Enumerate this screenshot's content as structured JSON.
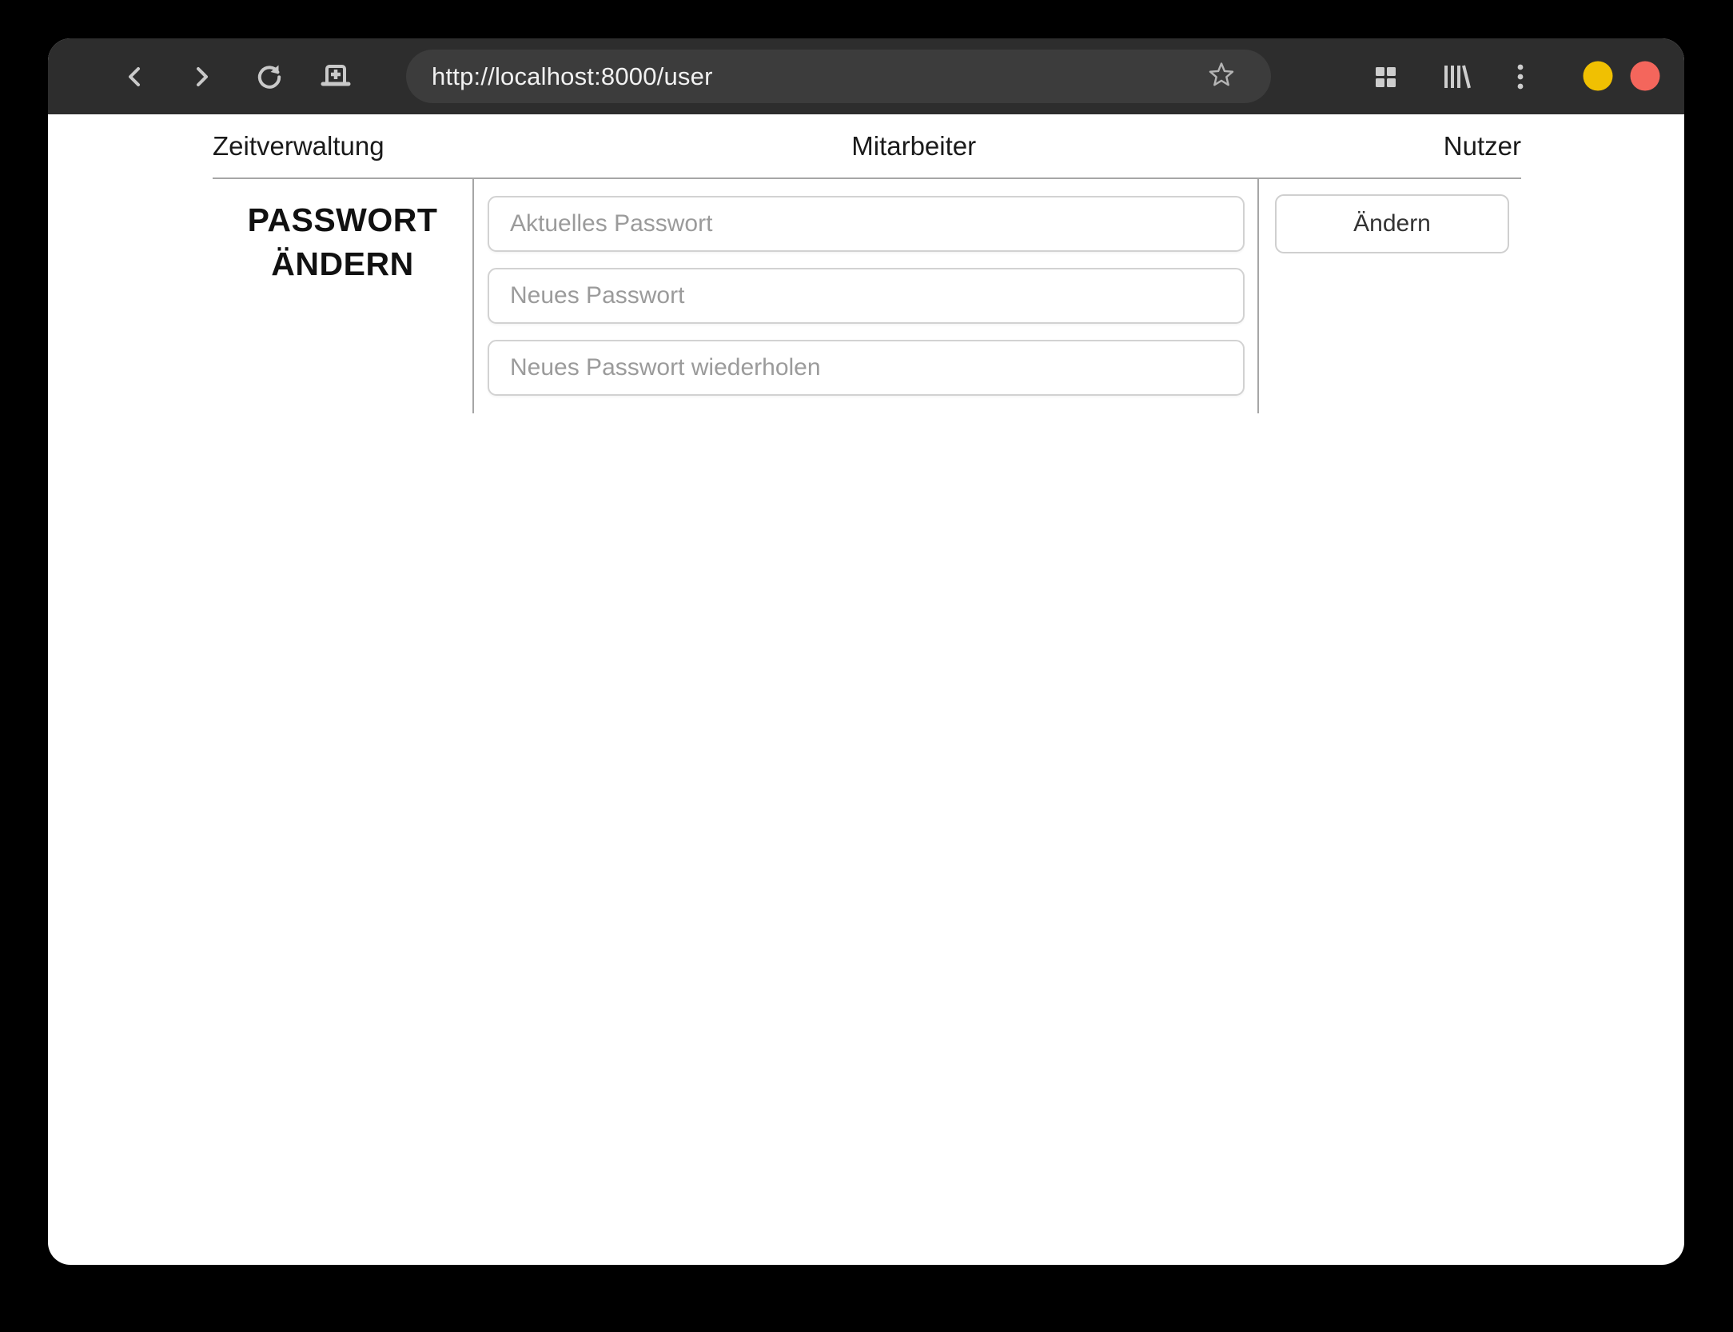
{
  "browser": {
    "url": "http://localhost:8000/user",
    "icons": [
      "back-icon",
      "forward-icon",
      "reload-icon",
      "new-tab-icon",
      "star-icon",
      "grid-icon",
      "library-icon",
      "kebab-menu-icon"
    ],
    "window_controls": {
      "minimize_color": "#f0c002",
      "close_color": "#f4665c"
    },
    "toolbar_bg": "#2d2d2d",
    "urlbar_bg": "#3c3c3c"
  },
  "nav": {
    "items": [
      {
        "label": "Zeitverwaltung"
      },
      {
        "label": "Mitarbeiter"
      },
      {
        "label": "Nutzer"
      }
    ]
  },
  "password_section": {
    "title_line1": "PASSWORT",
    "title_line2": "ÄNDERN",
    "fields": [
      {
        "placeholder": "Aktuelles Passwort",
        "value": ""
      },
      {
        "placeholder": "Neues Passwort",
        "value": ""
      },
      {
        "placeholder": "Neues Passwort wiederholen",
        "value": ""
      }
    ],
    "submit_label": "Ändern"
  },
  "colors": {
    "divider": "#a6a6a6",
    "input_border": "#d2d2d2",
    "placeholder": "#9b9b9b"
  }
}
